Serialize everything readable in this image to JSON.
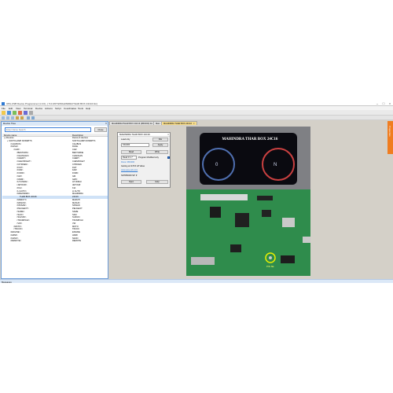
{
  "window": {
    "title": "UPA-USB Device Programmer [1.0.0] - [ 5.0.0/07/2/MAHINDRA/THAR BOX 24C16.bin]",
    "controls": [
      "–",
      "□",
      "×"
    ]
  },
  "menu": [
    "File",
    "Edit",
    "View",
    "Terminal",
    "Device",
    "Actions",
    "Script",
    "Coordinates",
    "Tools",
    "Help"
  ],
  "device_panel": {
    "title": "Device Tree",
    "search_placeholder": "Enter Name Search",
    "search_button": "Close",
    "columns": [
      "Device name",
      "Description"
    ],
    "rows": [
      {
        "name": "(-) Devices",
        "desc": "Device & devices",
        "indent": 0
      },
      {
        "name": "+ SOFTCLAMP NOSMPTS",
        "desc": "SOFTCLAMP NOSMPTS",
        "indent": 1
      },
      {
        "name": "<CALIBUS>",
        "desc": "CALIBUS",
        "indent": 2
      },
      {
        "name": "<DASH>",
        "desc": "DASH",
        "indent": 2
      },
      {
        "name": "<CAR>",
        "desc": "CAR",
        "indent": 3
      },
      {
        "name": "<BESTURN>",
        "desc": "BESTURNE",
        "indent": 4
      },
      {
        "name": "<CHANGAN>",
        "desc": "CHANGAN",
        "indent": 4
      },
      {
        "name": "<CHERY>",
        "desc": "CHERY",
        "indent": 4
      },
      {
        "name": "<CHEVROLET>",
        "desc": "CHEVROLET",
        "indent": 4
      },
      {
        "name": "<CITROEN>",
        "desc": "CITROEN",
        "indent": 4
      },
      {
        "name": "<FIAT>",
        "desc": "FIAT",
        "indent": 4
      },
      {
        "name": "<FAW>",
        "desc": "FAW",
        "indent": 4
      },
      {
        "name": "<FORD>",
        "desc": "FORD",
        "indent": 4
      },
      {
        "name": "<GM>",
        "desc": "GM",
        "indent": 4
      },
      {
        "name": "<GWM>",
        "desc": "GWC",
        "indent": 4
      },
      {
        "name": "<HYUNDAI>",
        "desc": "HYUNDAI",
        "indent": 4
      },
      {
        "name": "<JETOUR>",
        "desc": "JETOUR",
        "indent": 4
      },
      {
        "name": "<KIA>",
        "desc": "KIA",
        "indent": 4
      },
      {
        "name": "<LI AUTO>",
        "desc": "LI AUTO",
        "indent": 4
      },
      {
        "name": "<MAHINDRA>",
        "desc": "MAHINDRA",
        "indent": 4
      },
      {
        "name": "THAR BOX 24C16",
        "desc": "24C16",
        "indent": 5
      },
      {
        "name": "<MARUTI>",
        "desc": "MARUTI",
        "indent": 4
      },
      {
        "name": "<MASUN>",
        "desc": "MASUN",
        "indent": 4
      },
      {
        "name": "<NISSAN>",
        "desc": "NISSAN",
        "indent": 4
      },
      {
        "name": "<PEUGEOT>",
        "desc": "PEUGEOT",
        "indent": 4
      },
      {
        "name": "<SAME>",
        "desc": "SAME",
        "indent": 4
      },
      {
        "name": "<SAIC>",
        "desc": "SAIC",
        "indent": 4
      },
      {
        "name": "<SUZUKI>",
        "desc": "SUZUKI",
        "indent": 4
      },
      {
        "name": "<TRUMPCHI>",
        "desc": "TRUMPCHI",
        "indent": 4
      },
      {
        "name": "<VW>",
        "desc": "VW",
        "indent": 4
      },
      {
        "name": "<MOTO>",
        "desc": "MOTO",
        "indent": 3
      },
      {
        "name": "<TRUCK>",
        "desc": "TRUCK",
        "indent": 3
      },
      {
        "name": "<ENGINE>",
        "desc": "ENGINE",
        "indent": 2
      },
      {
        "name": "<HDMI>",
        "desc": "HDMI",
        "indent": 2
      },
      {
        "name": "<NANO>",
        "desc": "NANO",
        "indent": 2
      },
      {
        "name": "<REMOTE>",
        "desc": "REMOTE",
        "indent": 2
      }
    ],
    "selected_row": 20
  },
  "tabs": [
    {
      "label": "MAHINDRA/THAR BOX 24C16 (0BC000) bin",
      "active": false
    },
    {
      "label": "Main",
      "active": false
    },
    {
      "label": "MAHINDRA THAR BOX 24C16",
      "active": true
    }
  ],
  "right_dock_label": "Properties",
  "dialog": {
    "title": "MAHINDRA THAR BOX 24C16",
    "load_label": "Load only",
    "load_button": "File",
    "value": "K0A000",
    "apply_button": "Apply",
    "read_button": "Read",
    "write_button": "Write",
    "read_select": "Read 0 1.7",
    "program_label": "Program Modified only",
    "status": "Done: 0BC000",
    "info": "Getting at 0x7FF off Value",
    "link": "www.upa-usb.com",
    "footer": "SDTR5000 ISP ▼",
    "open_button": "Open",
    "help_button": "Help"
  },
  "photo": {
    "title_text": "MAHINDRA THAR BOX 24C16",
    "pin_label": "PIN 6E"
  },
  "status_bar": {
    "label": "Messages"
  },
  "colors": {
    "accent": "#2f7ad3",
    "active_tab": "#f6dc8c",
    "dock": "#f07d20",
    "panel_border": "#6a9ad6"
  }
}
